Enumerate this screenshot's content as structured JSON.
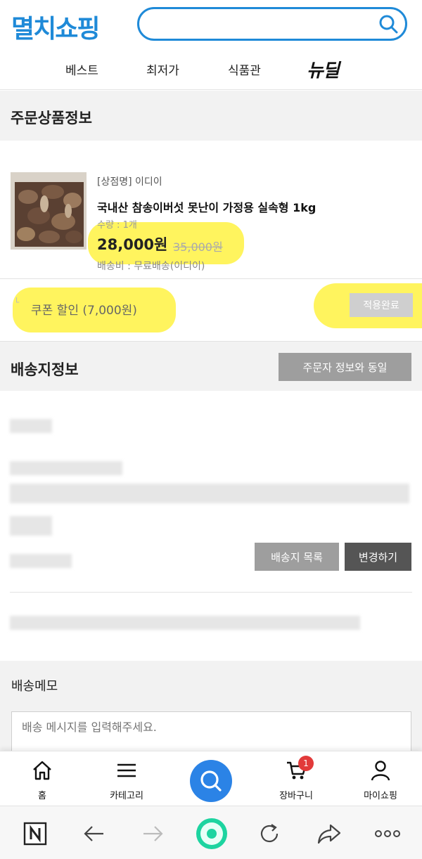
{
  "header": {
    "logo": "멸치쇼핑",
    "search_placeholder": "",
    "nav": [
      "베스트",
      "최저가",
      "식품관"
    ],
    "newdeal": "뉴딜"
  },
  "order": {
    "section_title": "주문상품정보",
    "store": "[상점명] 이디이",
    "product_name": "국내산 참송이버섯 못난이 가정용 실속형 1kg",
    "quantity": "수량 : 1개",
    "price": "28,000원",
    "original_price": "35,000원",
    "shipping": "배송비 : 무료배송(이디이)"
  },
  "coupon": {
    "label": "쿠폰 할인 (7,000원)",
    "applied_label": "적용완료"
  },
  "delivery": {
    "section_title": "배송지정보",
    "same_as_orderer": "주문자 정보와 동일",
    "address_list": "배송지 목록",
    "change": "변경하기"
  },
  "memo": {
    "title": "배송메모",
    "placeholder": "배송 메시지를 입력해주세요."
  },
  "tabbar": {
    "home": "홈",
    "category": "카테고리",
    "cart": "장바구니",
    "cart_count": "1",
    "mypage": "마이쇼핑"
  },
  "colors": {
    "brand_blue": "#1f8ad8",
    "highlight": "#fff028",
    "badge_red": "#e23a3a",
    "browser_green": "#1dd4a0"
  }
}
